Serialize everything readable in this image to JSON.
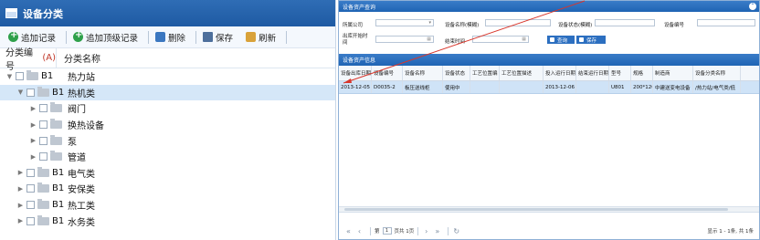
{
  "left_panel": {
    "title": "设备分类",
    "toolbar": {
      "add_record": "追加记录",
      "add_top_record": "追加顶级记录",
      "delete": "删除",
      "save": "保存",
      "refresh": "刷新"
    },
    "columns": {
      "code": "分类编号",
      "code_sort": "(A)",
      "name": "分类名称"
    },
    "tree": [
      {
        "code": "B1",
        "name": "热力站",
        "level": 0,
        "expanded": true,
        "selected": false
      },
      {
        "code": "B1",
        "name": "热机类",
        "level": 1,
        "expanded": true,
        "selected": true
      },
      {
        "code": "",
        "name": "阀门",
        "level": 2,
        "expanded": false,
        "selected": false
      },
      {
        "code": "",
        "name": "换热设备",
        "level": 2,
        "expanded": false,
        "selected": false
      },
      {
        "code": "",
        "name": "泵",
        "level": 2,
        "expanded": false,
        "selected": false
      },
      {
        "code": "",
        "name": "管道",
        "level": 2,
        "expanded": false,
        "selected": false
      },
      {
        "code": "B1",
        "name": "电气类",
        "level": 1,
        "expanded": false,
        "selected": false
      },
      {
        "code": "B1",
        "name": "安保类",
        "level": 1,
        "expanded": false,
        "selected": false
      },
      {
        "code": "B1",
        "name": "热工类",
        "level": 1,
        "expanded": false,
        "selected": false
      },
      {
        "code": "B1",
        "name": "水务类",
        "level": 1,
        "expanded": false,
        "selected": false
      }
    ]
  },
  "right_panel": {
    "query_title": "设备资产查询",
    "query": {
      "company_label": "所属公司",
      "device_name_label": "设备名称(模糊)",
      "device_status_label": "设备状态(模糊)",
      "device_code_label": "设备编号",
      "from_date_label": "出库开始时间",
      "end_time_label": "结束时间",
      "query_button": "查询",
      "save_button": "保存"
    },
    "info_title": "设备资产信息",
    "grid": {
      "columns": [
        "设备出库日期",
        "设备编号",
        "设备名称",
        "设备状态",
        "工艺位置编",
        "工艺位置描述",
        "投入运行日期",
        "结束运行日期",
        "型号",
        "规格",
        "制造商",
        "设备分类名称"
      ],
      "rows": [
        [
          "2013-12-05",
          "D0035-2",
          "板压送线柜",
          "使用中",
          "",
          "",
          "2013-12-06",
          "",
          "U801",
          "200*120",
          "中建送变电设备",
          "/热力站/电气类/低"
        ]
      ]
    },
    "pager": {
      "page_label": "第",
      "page_value": "1",
      "total_label": "页共 1页",
      "info": "显示 1 - 1条, 共 1条"
    }
  },
  "colors": {
    "header_blue": "#1f64b4",
    "selected_row": "#cfe3f7",
    "annotation_red": "#d9362b"
  }
}
